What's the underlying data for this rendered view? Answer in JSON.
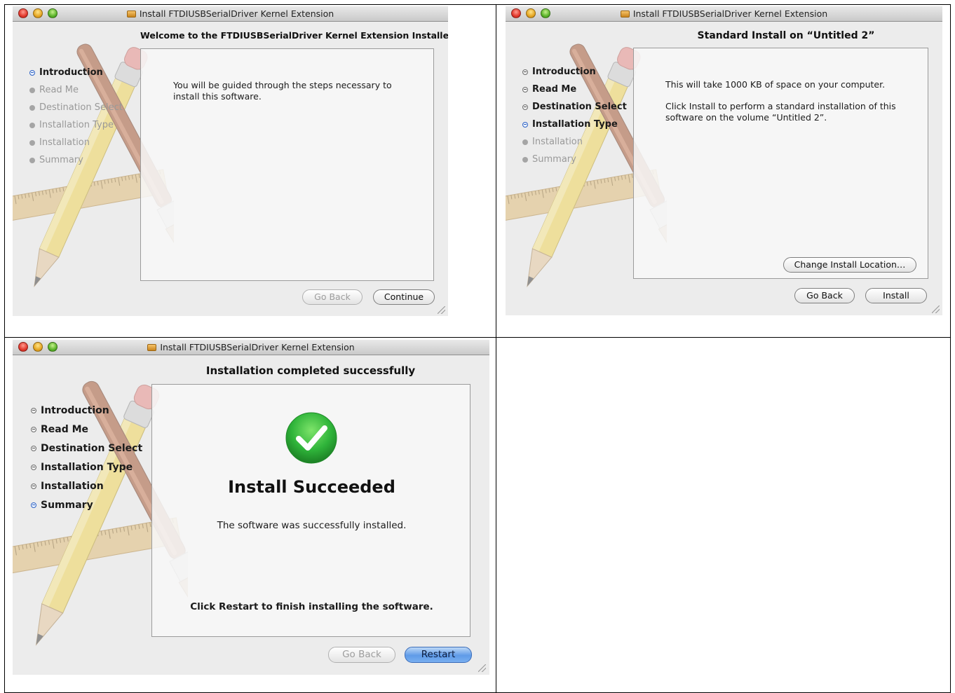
{
  "app_title": "Install FTDIUSBSerialDriver Kernel Extension",
  "colors": {
    "window_bg": "#ececec",
    "accent_blue": "#2e62c4",
    "success_green": "#2fb43a"
  },
  "icons": {
    "pkg": "package-icon",
    "success": "checkmark-icon"
  },
  "windows": [
    {
      "heading": "Welcome to the FTDIUSBSerialDriver Kernel Extension Installer",
      "steps": [
        {
          "label": "Introduction",
          "state": "current"
        },
        {
          "label": "Read Me",
          "state": "pending"
        },
        {
          "label": "Destination Select",
          "state": "pending"
        },
        {
          "label": "Installation Type",
          "state": "pending"
        },
        {
          "label": "Installation",
          "state": "pending"
        },
        {
          "label": "Summary",
          "state": "pending"
        }
      ],
      "body": "You will be guided through the steps necessary to install this software.",
      "back_label": "Go Back",
      "primary_label": "Continue"
    },
    {
      "heading": "Standard Install on “Untitled 2”",
      "steps": [
        {
          "label": "Introduction",
          "state": "done"
        },
        {
          "label": "Read Me",
          "state": "done"
        },
        {
          "label": "Destination Select",
          "state": "done"
        },
        {
          "label": "Installation Type",
          "state": "current"
        },
        {
          "label": "Installation",
          "state": "pending"
        },
        {
          "label": "Summary",
          "state": "pending"
        }
      ],
      "body_line1": "This will take 1000 KB of space on your computer.",
      "body_line2": "Click Install to perform a standard installation of this software on the volume “Untitled 2”.",
      "change_location_label": "Change Install Location…",
      "back_label": "Go Back",
      "primary_label": "Install"
    },
    {
      "heading": "Installation completed successfully",
      "steps": [
        {
          "label": "Introduction",
          "state": "done"
        },
        {
          "label": "Read Me",
          "state": "done"
        },
        {
          "label": "Destination Select",
          "state": "done"
        },
        {
          "label": "Installation Type",
          "state": "done"
        },
        {
          "label": "Installation",
          "state": "done"
        },
        {
          "label": "Summary",
          "state": "current"
        }
      ],
      "success_title": "Install Succeeded",
      "success_text": "The software was successfully installed.",
      "restart_hint": "Click Restart to finish installing the software.",
      "back_label": "Go Back",
      "primary_label": "Restart"
    }
  ]
}
